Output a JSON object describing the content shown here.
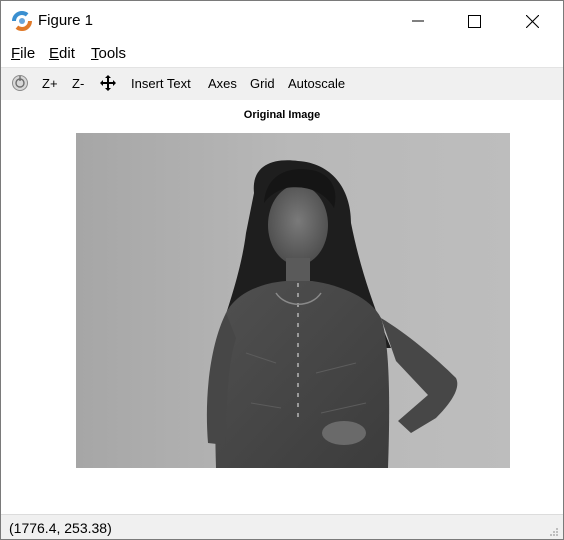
{
  "window": {
    "title": "Figure 1"
  },
  "menu": {
    "file_underline": "F",
    "file_rest": "ile",
    "edit_underline": "E",
    "edit_rest": "dit",
    "tools_underline": "T",
    "tools_rest": "ools"
  },
  "toolbar": {
    "zoom_in": "Z+",
    "zoom_out": "Z-",
    "insert_text": "Insert Text",
    "axes": "Axes",
    "grid": "Grid",
    "autoscale": "Autoscale"
  },
  "plot": {
    "title": "Original Image"
  },
  "status": {
    "coords": "(1776.4, 253.38)"
  }
}
